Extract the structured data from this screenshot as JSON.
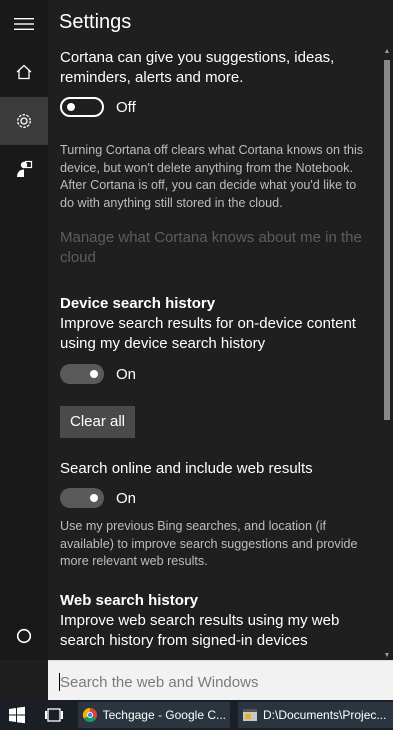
{
  "app": {
    "title": "Settings"
  },
  "rail": {
    "items": [
      {
        "name": "menu",
        "icon": "hamburger-icon"
      },
      {
        "name": "home",
        "icon": "home-icon"
      },
      {
        "name": "settings",
        "icon": "gear-icon",
        "active": true
      },
      {
        "name": "feedback",
        "icon": "feedback-icon"
      },
      {
        "name": "cortana",
        "icon": "cortana-circle-icon"
      }
    ]
  },
  "settings": {
    "cortana_intro": "Cortana can give you suggestions, ideas, reminders, alerts and more.",
    "cortana_toggle_state": "Off",
    "cortana_off_note": "Turning Cortana off clears what Cortana knows on this device, but won't delete anything from the Notebook. After Cortana is off, you can decide what you'd like to do with anything still stored in the cloud.",
    "manage_link": "Manage what Cortana knows about me in the cloud",
    "device_history_heading": "Device search history",
    "device_history_desc": "Improve search results for on-device content using my device search history",
    "device_history_toggle_state": "On",
    "clear_all_label": "Clear all",
    "web_results_label": "Search online and include web results",
    "web_results_toggle_state": "On",
    "web_results_note": "Use my previous Bing searches, and location (if available) to improve search suggestions and provide more relevant web results.",
    "web_history_heading": "Web search history",
    "web_history_desc": "Improve web search results using my web search history from signed-in devices"
  },
  "search": {
    "placeholder": "Search the web and Windows"
  },
  "taskbar": {
    "tasks": [
      {
        "label": "Techgage - Google C...",
        "icon": "chrome-icon"
      },
      {
        "label": "D:\\Documents\\Projec...",
        "icon": "explorer-window-icon"
      }
    ]
  },
  "colors": {
    "background": "#1f1f1f",
    "rail": "#191919",
    "accent_muted": "#5d5d5d",
    "taskbar": "#1a1f26"
  }
}
